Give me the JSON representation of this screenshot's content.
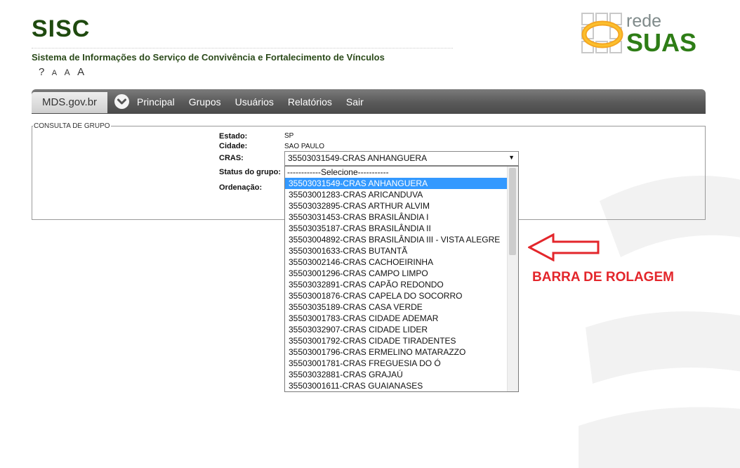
{
  "app": {
    "title": "SISC",
    "subtitle": "Sistema de Informações do Serviço de Convivência e Fortalecimento de Vínculos",
    "tools": [
      "?",
      "A",
      "A",
      "A"
    ]
  },
  "logo": {
    "line1": "rede",
    "line2": "SUAS"
  },
  "nav": {
    "brand": "MDS.gov.br",
    "items": [
      "Principal",
      "Grupos",
      "Usuários",
      "Relatórios",
      "Sair"
    ]
  },
  "form": {
    "legend": "CONSULTA DE GRUPO",
    "labels": {
      "estado": "Estado:",
      "cidade": "Cidade:",
      "cras": "CRAS:",
      "status": "Status do grupo:",
      "ordenacao": "Ordenação:"
    },
    "values": {
      "estado": "SP",
      "cidade": "SAO PAULO"
    },
    "cras_selected": "35503031549-CRAS ANHANGUERA",
    "cras_options": [
      "------------Selecione-----------",
      "35503031549-CRAS ANHANGUERA",
      "35503001283-CRAS ARICANDUVA",
      "35503032895-CRAS ARTHUR ALVIM",
      "35503031453-CRAS BRASILÂNDIA I",
      "35503035187-CRAS BRASILÂNDIA II",
      "35503004892-CRAS BRASILÂNDIA III - VISTA ALEGRE",
      "35503001633-CRAS BUTANTÃ",
      "35503002146-CRAS CACHOEIRINHA",
      "35503001296-CRAS CAMPO LIMPO",
      "35503032891-CRAS CAPÃO REDONDO",
      "35503001876-CRAS CAPELA DO SOCORRO",
      "35503035189-CRAS CASA VERDE",
      "35503001783-CRAS CIDADE ADEMAR",
      "35503032907-CRAS CIDADE LIDER",
      "35503001792-CRAS CIDADE TIRADENTES",
      "35503001796-CRAS ERMELINO MATARAZZO",
      "35503001781-CRAS FREGUESIA DO Ó",
      "35503032881-CRAS GRAJAÚ",
      "35503001611-CRAS GUAIANASES"
    ],
    "selected_index": 1
  },
  "annotation": {
    "text": "BARRA DE ROLAGEM",
    "color": "#e3262b"
  },
  "colors": {
    "title": "#1f4a0f",
    "nav": "#595959",
    "highlight": "#3399ff",
    "suas": "#2e7d16"
  }
}
